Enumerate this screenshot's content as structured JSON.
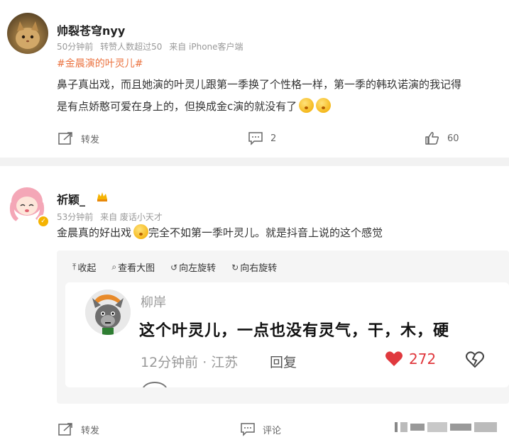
{
  "post1": {
    "username": "帅裂苍穹nyy",
    "meta": {
      "time": "50分钟前",
      "reposts": "转赞人数超过50",
      "source": "来自 iPhone客户端"
    },
    "hashtag": "#金晨演的叶灵儿#",
    "text_line1": "鼻子真出戏，而且她演的叶灵儿跟第一季换了个性格一样，第一季的韩玖诺演的我记得",
    "text_line2": "是有点娇憨可爱在身上的，但换成金c演的就没有了",
    "actions": {
      "repost": "转发",
      "comment_count": "2",
      "like_count": "60"
    }
  },
  "post2": {
    "username": "祈颖_",
    "meta": {
      "time": "53分钟前",
      "source": "来自 废话小天才"
    },
    "text_before": "金晨真的好出戏",
    "text_after": "完全不如第一季叶灵儿。就是抖音上说的这个感觉",
    "image_tools": [
      {
        "glyph": "⤒",
        "label": "收起"
      },
      {
        "glyph": "⌕",
        "label": "查看大图"
      },
      {
        "glyph": "↺",
        "label": "向左旋转"
      },
      {
        "glyph": "↻",
        "label": "向右旋转"
      }
    ],
    "quoted_comment": {
      "name": "柳岸",
      "text": "这个叶灵儿，一点也没有灵气，干，木，硬",
      "time": "12分钟前 · 江苏",
      "reply": "回复",
      "likes": "272"
    },
    "actions": {
      "repost": "转发",
      "comment": "评论"
    }
  },
  "colors": {
    "accent": "#eb7340",
    "like_red": "#e0393e",
    "muted": "#999999",
    "page_bg": "#f2f2f2"
  }
}
